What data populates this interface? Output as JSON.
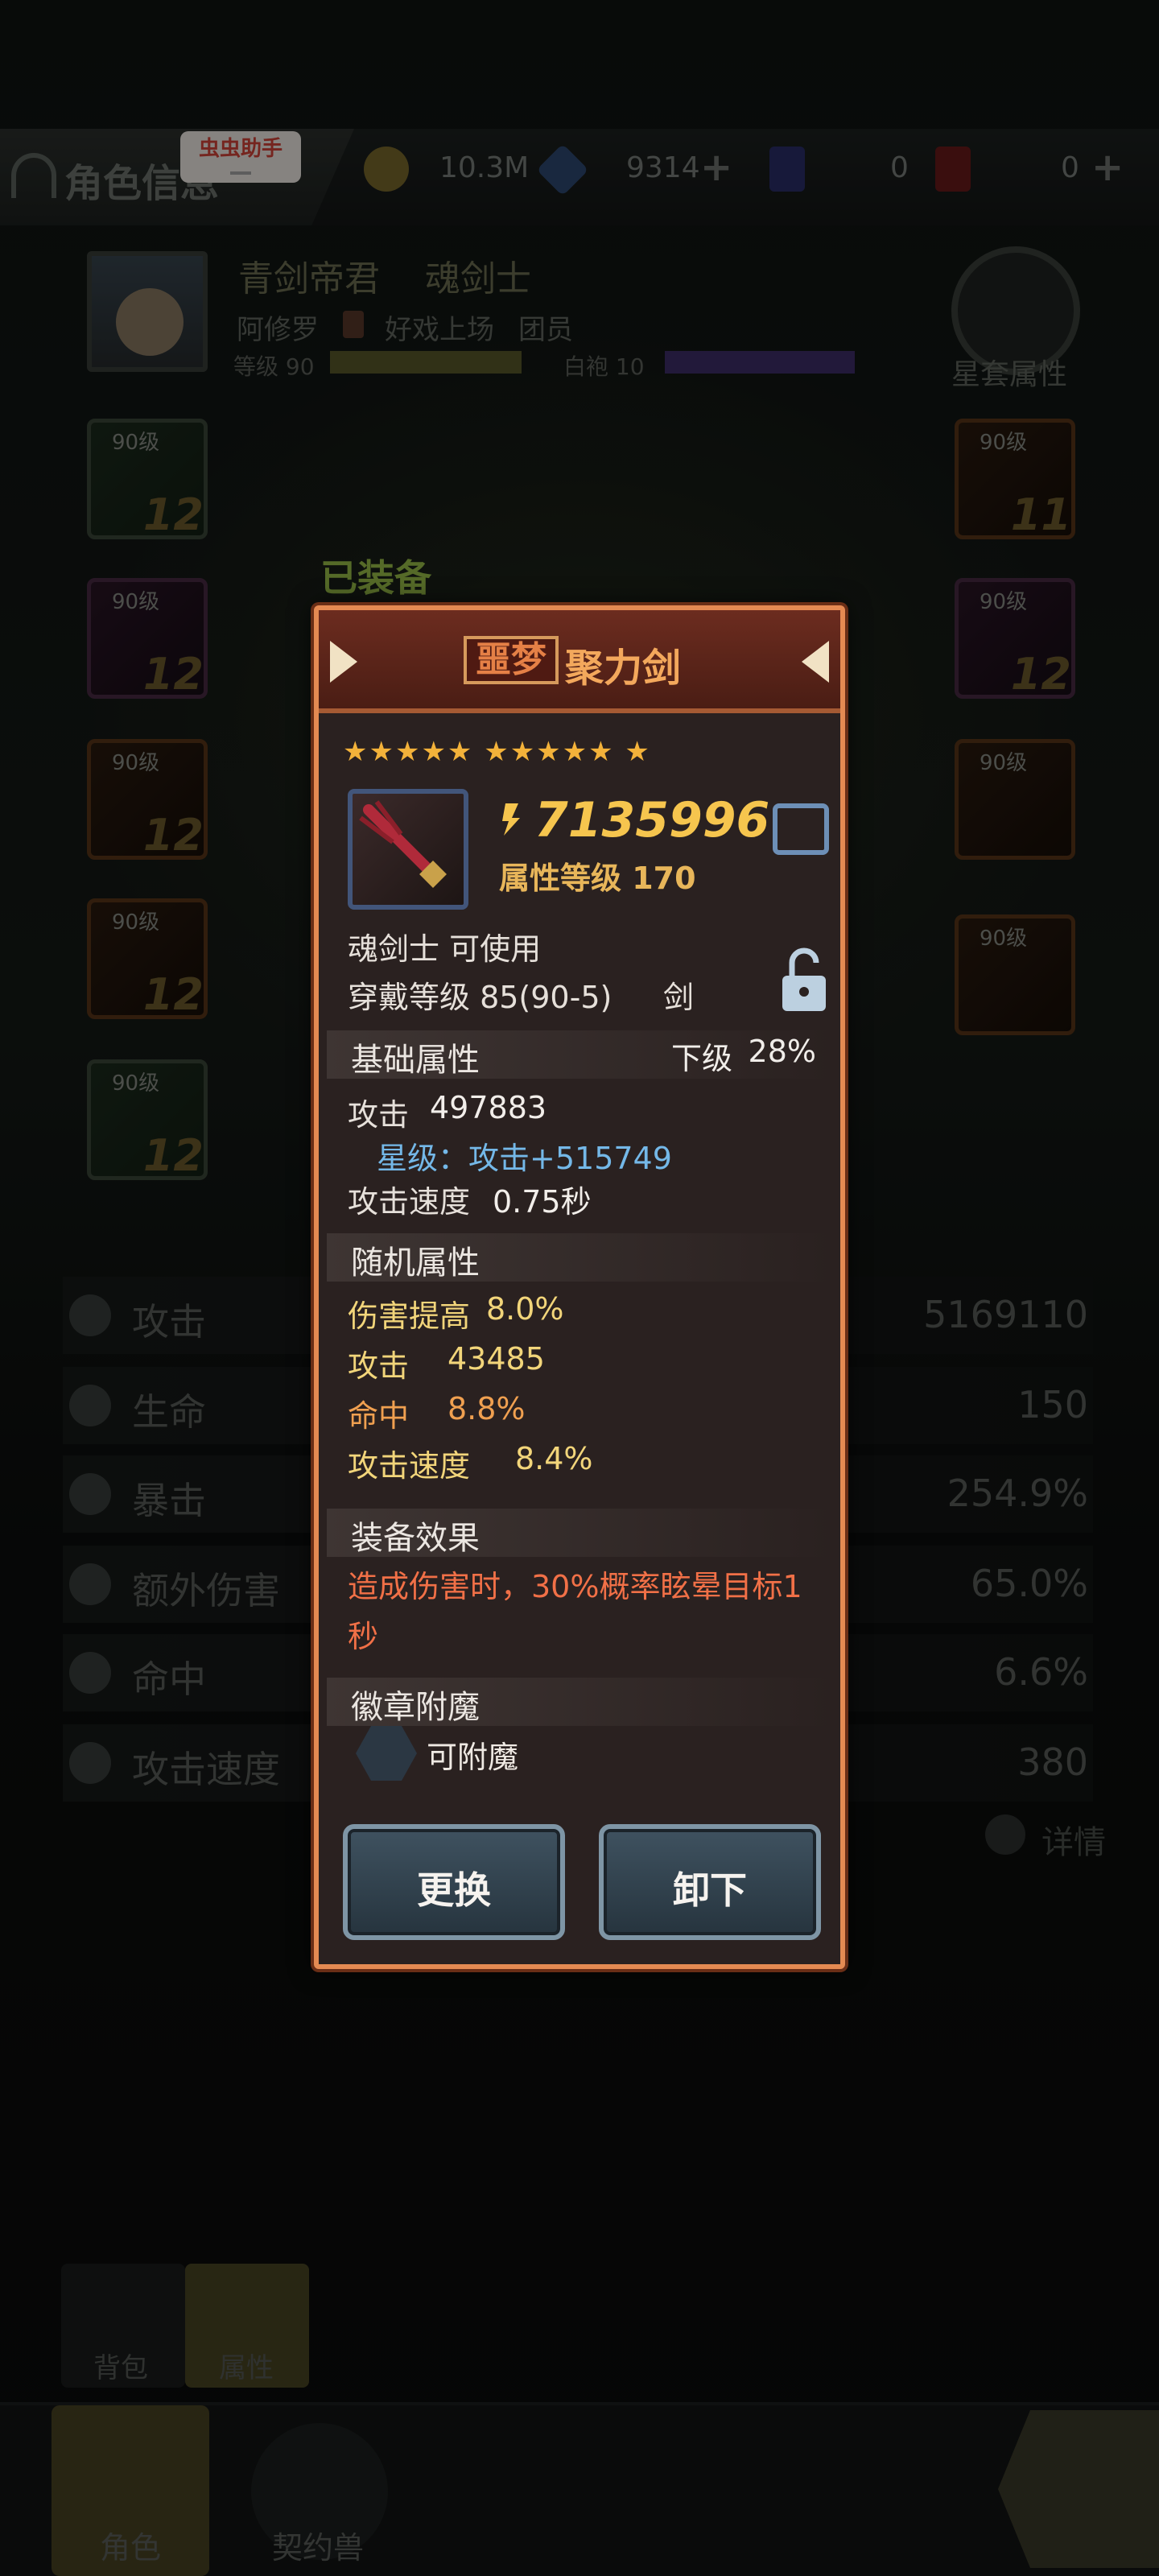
{
  "topbar": {
    "title": "角色信息",
    "helper_badge": "虫虫助手",
    "gold": "10.3M",
    "gems": "9314",
    "ticket_purple": "0",
    "ticket_red": "0",
    "plus": "+"
  },
  "character": {
    "name": "青剑帝君",
    "class": "魂剑士",
    "nickname": "阿修罗",
    "guild": "好戏上场",
    "role": "团员",
    "level_label": "等级 90",
    "robe_label": "白袍 10",
    "set_attr_label": "星套属性"
  },
  "slots": {
    "left": [
      {
        "level": "90级",
        "enhance": "12"
      },
      {
        "level": "90级",
        "enhance": "12"
      },
      {
        "level": "90级",
        "enhance": "12"
      },
      {
        "level": "90级",
        "enhance": "12"
      },
      {
        "level": "90级",
        "enhance": "12"
      }
    ],
    "right": [
      {
        "level": "90级",
        "enhance": "11"
      },
      {
        "level": "90级",
        "enhance": "12"
      },
      {
        "level": "90级",
        "enhance": ""
      },
      {
        "level": "90级",
        "enhance": ""
      }
    ],
    "equipped_tag": "已装备"
  },
  "attributes": [
    {
      "label": "攻击",
      "value": "5169110"
    },
    {
      "label": "生命",
      "value": "150"
    },
    {
      "label": "暴击",
      "value": "254.9%"
    },
    {
      "label": "额外伤害",
      "value": "65.0%"
    },
    {
      "label": "命中",
      "value": "6.6%"
    },
    {
      "label": "攻击速度",
      "value": "380"
    }
  ],
  "detail_link": "详情",
  "subtabs": {
    "bag": "背包",
    "attr": "属性"
  },
  "nav": {
    "character": "角色",
    "pet": "契约兽"
  },
  "popup": {
    "tag": "噩梦",
    "name": "聚力剑",
    "stars": "★★★★★ ★★★★★ ★",
    "power": "7135996",
    "attr_level": "属性等级 170",
    "usable": "魂剑士 可使用",
    "wear_level": "穿戴等级 85(90-5)",
    "weapon_type": "剑",
    "basic_title": "基础属性",
    "tier_label": "下级",
    "tier_value": "28%",
    "basic_attack_label": "攻击",
    "basic_attack_value": "497883",
    "star_bonus": "星级：攻击+515749",
    "speed_label": "攻击速度",
    "speed_value": "0.75秒",
    "random_title": "随机属性",
    "random": [
      {
        "label": "伤害提高",
        "value": "8.0%"
      },
      {
        "label": "攻击",
        "value": "43485"
      },
      {
        "label": "命中",
        "value": "8.8%"
      },
      {
        "label": "攻击速度",
        "value": "8.4%"
      }
    ],
    "effect_title": "装备效果",
    "effect_text": "造成伤害时，30%概率眩晕目标1秒",
    "badge_title": "徽章附魔",
    "enchant_label": "可附魔",
    "replace_button": "更换",
    "unequip_button": "卸下"
  }
}
